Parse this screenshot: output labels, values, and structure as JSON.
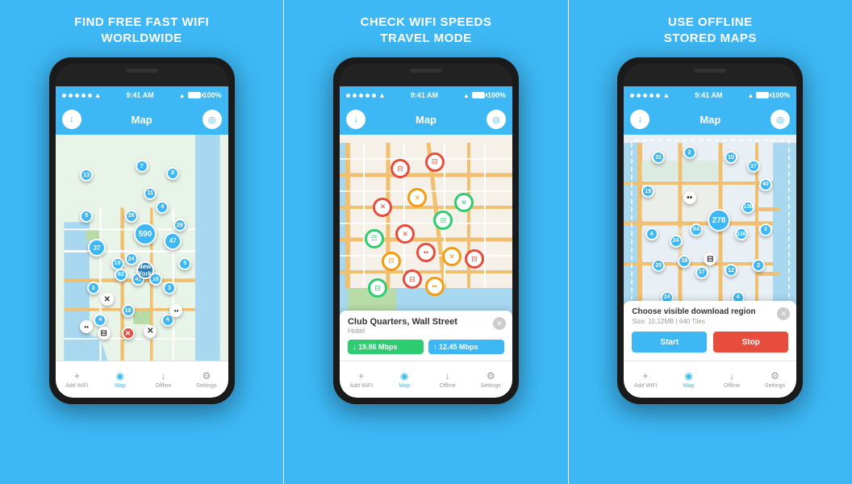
{
  "panels": [
    {
      "id": "panel-1",
      "title": "FIND FREE FAST WIFI\nWORLDWIDE",
      "phone": {
        "status": {
          "time": "9:41 AM",
          "battery": "100%"
        },
        "header": {
          "title": "Map"
        },
        "nav": [
          {
            "label": "Add WiFi",
            "icon": "+"
          },
          {
            "label": "Map",
            "icon": "◉",
            "active": true
          },
          {
            "label": "Offline",
            "icon": "↓"
          },
          {
            "label": "Settings",
            "icon": "⚙"
          }
        ]
      }
    },
    {
      "id": "panel-2",
      "title": "CHECK WIFI SPEEDS\nTRAVEL MODE",
      "phone": {
        "status": {
          "time": "9:41 AM",
          "battery": "100%"
        },
        "header": {
          "title": "Map"
        },
        "popup": {
          "title": "Club Quarters, Wall Street",
          "subtitle": "Hotel",
          "speed_down": "↓ 19.86 Mbps",
          "speed_up": "↑ 12.45 Mbps"
        },
        "nav": [
          {
            "label": "Add WiFi",
            "icon": "+"
          },
          {
            "label": "Map",
            "icon": "◉",
            "active": true
          },
          {
            "label": "Offline",
            "icon": "↓"
          },
          {
            "label": "Settings",
            "icon": "⚙"
          }
        ]
      }
    },
    {
      "id": "panel-3",
      "title": "USE OFFLINE\nSTORED MAPS",
      "phone": {
        "status": {
          "time": "9:41 AM",
          "battery": "100%"
        },
        "header": {
          "title": "Map"
        },
        "download": {
          "title": "Choose visible download region",
          "meta": "Size: 15.12MB | 640 Tiles",
          "btn_start": "Start",
          "btn_stop": "Stop"
        },
        "nav": [
          {
            "label": "Add WiFi",
            "icon": "+"
          },
          {
            "label": "Map",
            "icon": "◉",
            "active": true
          },
          {
            "label": "Offline",
            "icon": "↓"
          },
          {
            "label": "Settings",
            "icon": "⚙"
          }
        ]
      }
    }
  ],
  "colors": {
    "sky": "#3db8f5",
    "blue_marker": "#3db8f5",
    "red_marker": "#e74c3c",
    "green_marker": "#2ecc71",
    "orange_marker": "#f39c12"
  }
}
